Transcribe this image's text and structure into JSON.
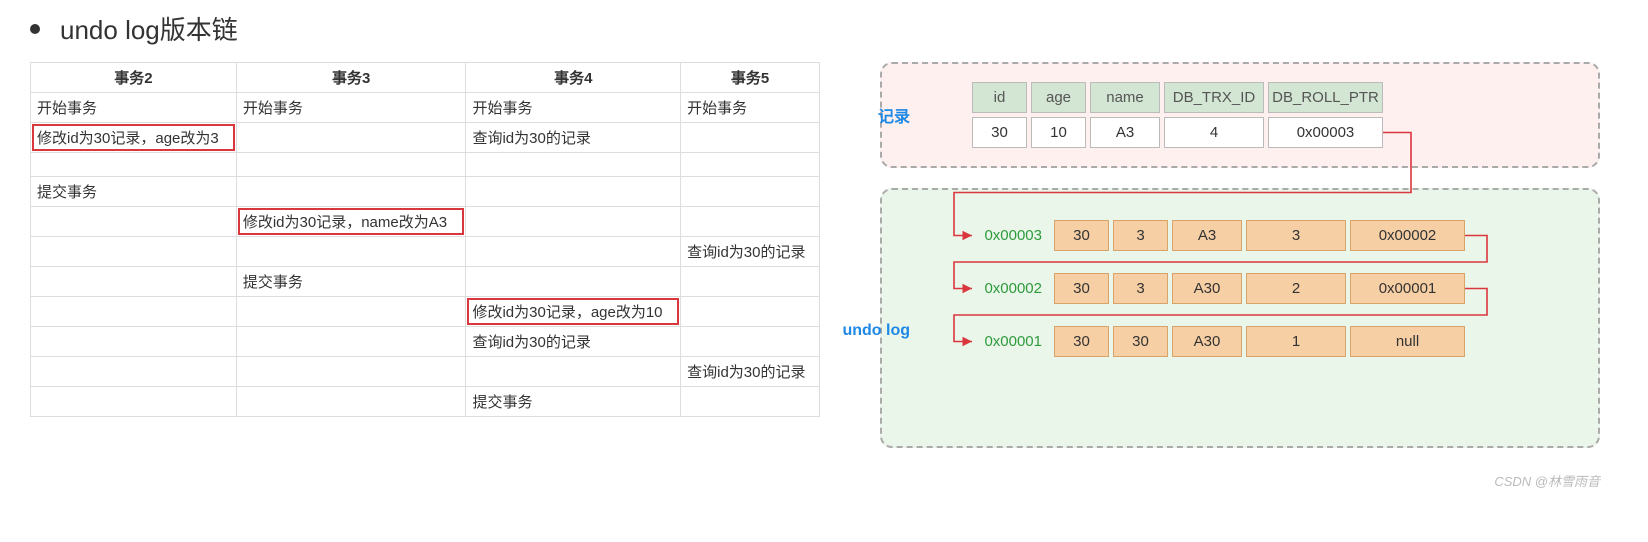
{
  "title": "undo log版本链",
  "tx_headers": [
    "事务2",
    "事务3",
    "事务4",
    "事务5"
  ],
  "tx_rows": [
    {
      "cells": [
        "开始事务",
        "开始事务",
        "开始事务",
        "开始事务"
      ],
      "hl": []
    },
    {
      "cells": [
        "修改id为30记录，age改为3",
        "",
        "查询id为30的记录",
        ""
      ],
      "hl": [
        0
      ]
    },
    {
      "cells": [
        "",
        "",
        "",
        ""
      ],
      "hl": []
    },
    {
      "cells": [
        "提交事务",
        "",
        "",
        ""
      ],
      "hl": []
    },
    {
      "cells": [
        "",
        "修改id为30记录，name改为A3",
        "",
        ""
      ],
      "hl": [
        1
      ]
    },
    {
      "cells": [
        "",
        "",
        "",
        "查询id为30的记录"
      ],
      "hl": []
    },
    {
      "cells": [
        "",
        "提交事务",
        "",
        ""
      ],
      "hl": []
    },
    {
      "cells": [
        "",
        "",
        "修改id为30记录，age改为10",
        ""
      ],
      "hl": [
        2
      ]
    },
    {
      "cells": [
        "",
        "",
        "查询id为30的记录",
        ""
      ],
      "hl": []
    },
    {
      "cells": [
        "",
        "",
        "",
        "查询id为30的记录"
      ],
      "hl": []
    },
    {
      "cells": [
        "",
        "",
        "提交事务",
        ""
      ],
      "hl": []
    }
  ],
  "diagram": {
    "record_label": "记录",
    "undo_label": "undo log",
    "columns": [
      "id",
      "age",
      "name",
      "DB_TRX_ID",
      "DB_ROLL_PTR"
    ],
    "current": {
      "id": "30",
      "age": "10",
      "name": "A3",
      "trx": "4",
      "ptr": "0x00003"
    },
    "undo": [
      {
        "addr": "0x00003",
        "id": "30",
        "age": "3",
        "name": "A3",
        "trx": "3",
        "ptr": "0x00002"
      },
      {
        "addr": "0x00002",
        "id": "30",
        "age": "3",
        "name": "A30",
        "trx": "2",
        "ptr": "0x00001"
      },
      {
        "addr": "0x00001",
        "id": "30",
        "age": "30",
        "name": "A30",
        "trx": "1",
        "ptr": "null"
      }
    ]
  },
  "watermark": "CSDN @林雪雨音"
}
